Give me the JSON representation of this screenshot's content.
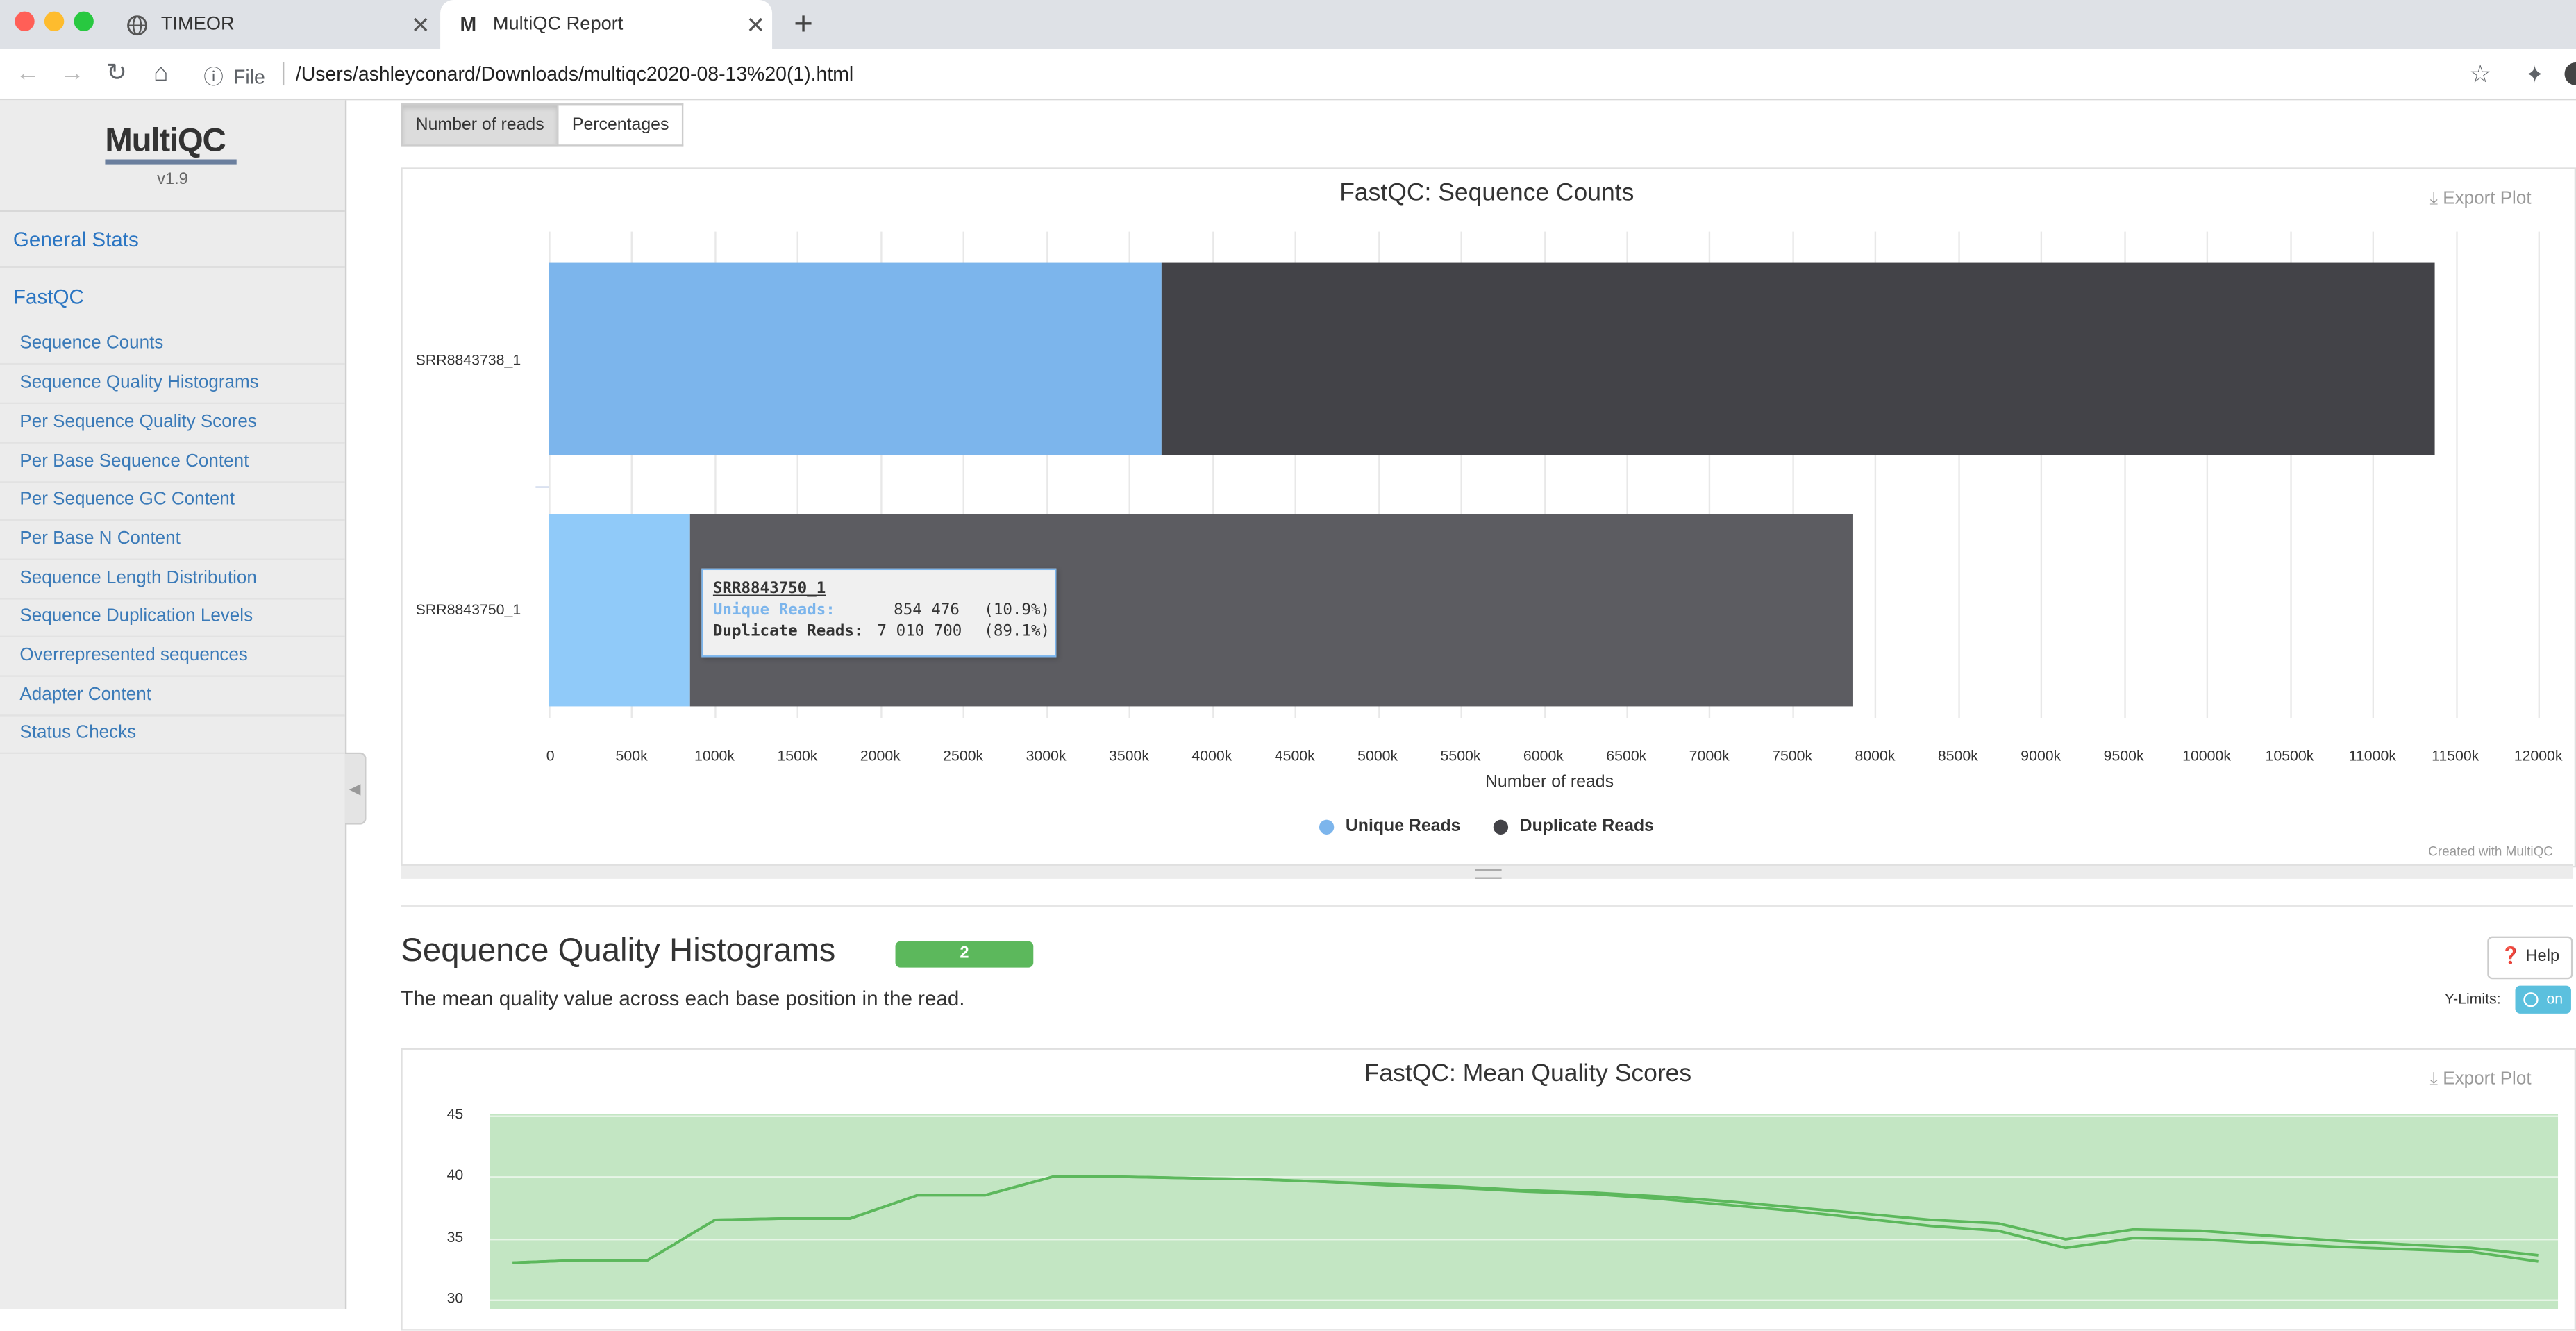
{
  "browser": {
    "tabs": [
      {
        "label": "TIMEOR",
        "favicon": "globe-icon",
        "active": false
      },
      {
        "label": "MultiQC Report",
        "favicon": "M",
        "active": true
      }
    ],
    "url_scheme_label": "File",
    "url": "/Users/ashleyconard/Downloads/multiqc2020-08-13%20(1).html"
  },
  "sidebar": {
    "logo": "MultiQC",
    "version": "v1.9",
    "main_items": [
      "General Stats",
      "FastQC"
    ],
    "sub_items": [
      "Sequence Counts",
      "Sequence Quality Histograms",
      "Per Sequence Quality Scores",
      "Per Base Sequence Content",
      "Per Sequence GC Content",
      "Per Base N Content",
      "Sequence Length Distribution",
      "Sequence Duplication Levels",
      "Overrepresented sequences",
      "Adapter Content",
      "Status Checks"
    ]
  },
  "counts_section": {
    "toggle_buttons": [
      "Number of reads",
      "Percentages"
    ],
    "export_label": "Export Plot",
    "credit": "Created with MultiQC",
    "tooltip": {
      "sample": "SRR8843750_1",
      "rows": [
        {
          "label": "Unique Reads:",
          "value": "854 476",
          "pct": "(10.9%)"
        },
        {
          "label": "Duplicate Reads:",
          "value": "7 010 700",
          "pct": "(89.1%)"
        }
      ]
    }
  },
  "quality_section": {
    "title": "Sequence Quality Histograms",
    "badge": "2",
    "help_label": "Help",
    "description": "The mean quality value across each base position in the read.",
    "ylimits_label": "Y-Limits:",
    "toggle_label": "on",
    "export_label": "Export Plot"
  },
  "colors": {
    "unique": "#7cb5ec",
    "duplicate": "#434348",
    "duplicate_muted": "#5c5c61",
    "unique_highlight": "#90caf9",
    "quality_bg": "#c3e6c3",
    "quality_line": "#5cb85c",
    "accent_link": "#2a75c2"
  },
  "chart_data": [
    {
      "type": "bar",
      "orientation": "horizontal",
      "stacked": true,
      "title": "FastQC: Sequence Counts",
      "xlabel": "Number of reads",
      "xlim": [
        0,
        12000000
      ],
      "x_ticks": [
        "0",
        "500k",
        "1000k",
        "1500k",
        "2000k",
        "2500k",
        "3000k",
        "3500k",
        "4000k",
        "4500k",
        "5000k",
        "5500k",
        "6000k",
        "6500k",
        "7000k",
        "7500k",
        "8000k",
        "8500k",
        "9000k",
        "9500k",
        "10000k",
        "10500k",
        "11000k",
        "11500k",
        "12000k"
      ],
      "categories": [
        "SRR8843738_1",
        "SRR8843750_1"
      ],
      "series": [
        {
          "name": "Unique Reads",
          "values": [
            3700000,
            854476
          ]
        },
        {
          "name": "Duplicate Reads",
          "values": [
            7680000,
            7010700
          ]
        }
      ],
      "legend": "bottom-center"
    },
    {
      "type": "line",
      "title": "FastQC: Mean Quality Scores",
      "y_ticks": [
        "45",
        "40",
        "35",
        "30"
      ],
      "ylim": [
        30,
        45
      ],
      "series": [
        {
          "values": [
            33.0,
            33.2,
            33.2,
            36.5,
            36.6,
            36.6,
            38.5,
            38.5,
            40.0,
            40.0,
            39.9,
            39.8,
            39.6,
            39.3,
            39.1,
            38.8,
            38.6,
            38.2,
            37.7,
            37.2,
            36.6,
            36.0,
            35.6,
            34.2,
            35.0,
            34.9,
            34.6,
            34.3,
            34.1,
            33.9,
            33.1
          ]
        },
        {
          "values": [
            33.0,
            33.2,
            33.2,
            36.5,
            36.6,
            36.6,
            38.5,
            38.5,
            40.0,
            40.0,
            39.9,
            39.8,
            39.6,
            39.4,
            39.2,
            38.9,
            38.7,
            38.4,
            38.0,
            37.5,
            37.0,
            36.5,
            36.2,
            34.9,
            35.7,
            35.6,
            35.2,
            34.8,
            34.5,
            34.2,
            33.6
          ]
        }
      ]
    }
  ]
}
